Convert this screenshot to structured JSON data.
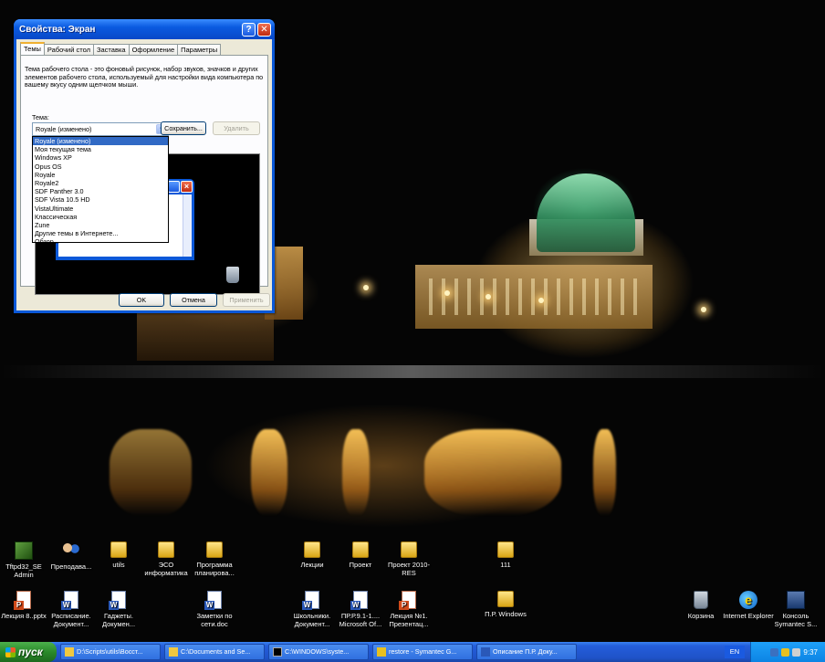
{
  "dialog": {
    "title": "Свойства: Экран",
    "help_btn": "?",
    "close_btn": "✕",
    "tabs": [
      "Темы",
      "Рабочий стол",
      "Заставка",
      "Оформление",
      "Параметры"
    ],
    "description": "Тема рабочего стола - это фоновый рисунок, набор звуков, значков и других элементов рабочего стола, используемый для настройки вида компьютера по вашему вкусу одним щелчком мыши.",
    "theme_label": "Тема:",
    "theme_value": "Royale (изменено)",
    "save_label": "Сохранить...",
    "delete_label": "Удалить",
    "theme_options": [
      "Royale (изменено)",
      "Моя текущая тема",
      "Windows XP",
      "Opus OS",
      "Royale",
      "Royale2",
      "SDF Panther 3.0",
      "SDF Vista 10.5 HD",
      "VistaUltimate",
      "Классическая",
      "Zune",
      "Другие темы в Интернете...",
      "Обзор..."
    ],
    "selected_option": 0,
    "ok_label": "OK",
    "cancel_label": "Отмена",
    "apply_label": "Применить"
  },
  "desktop_icons": [
    {
      "label": "Tftpd32_SE Admin",
      "icon": "app-icon"
    },
    {
      "label": "Преподава...",
      "icon": "people-icon"
    },
    {
      "label": "utils",
      "icon": "folder-icon"
    },
    {
      "label": "ЭСО информатика",
      "icon": "folder-icon"
    },
    {
      "label": "Программа планирова...",
      "icon": "folder-icon"
    },
    {
      "label": "Лекции",
      "icon": "folder-icon"
    },
    {
      "label": "Проект",
      "icon": "folder-icon"
    },
    {
      "label": "Проект 2010-RES",
      "icon": "folder-icon"
    },
    {
      "label": "111",
      "icon": "folder-icon"
    },
    {
      "label": "Лекция 8..pptx",
      "icon": "ppt-icon"
    },
    {
      "label": "Расписание. Документ...",
      "icon": "doc-icon"
    },
    {
      "label": "Гаджеты. Докумен...",
      "icon": "doc-icon"
    },
    {
      "label": "Заметки по сети.doc",
      "icon": "doc-icon"
    },
    {
      "label": "Школьники. Документ...",
      "icon": "doc-icon"
    },
    {
      "label": "ПР.Р.9.1-1.... Microsoft Of...",
      "icon": "doc-icon"
    },
    {
      "label": "Лекция №1. Презентац...",
      "icon": "ppt-icon"
    },
    {
      "label": "П.Р. Windows",
      "icon": "folder-icon"
    },
    {
      "label": "Корзина",
      "icon": "recycle-bin-icon"
    },
    {
      "label": "Internet Explorer",
      "icon": "ie-icon"
    },
    {
      "label": "Консоль Symantec S...",
      "icon": "console-icon"
    }
  ],
  "taskbar": {
    "start_label": "пуск",
    "buttons": [
      "D:\\Scripts\\utils\\Восст...",
      "C:\\Documents and Se...",
      "C:\\WINDOWS\\syste...",
      "restore - Symantec G...",
      "Описание П.Р. Доку..."
    ],
    "language": "EN",
    "clock": "9:37"
  }
}
